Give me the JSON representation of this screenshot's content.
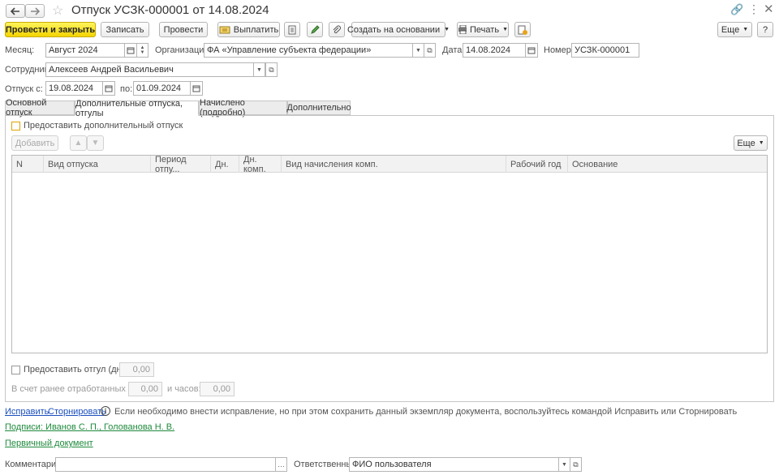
{
  "window": {
    "title": "Отпуск УСЗК-000001 от 14.08.2024"
  },
  "toolbar": {
    "post_close": "Провести и закрыть",
    "save": "Записать",
    "post": "Провести",
    "pay": "Выплатить",
    "create_based": "Создать на основании",
    "print": "Печать",
    "more": "Еще",
    "help": "?"
  },
  "header": {
    "month_label": "Месяц:",
    "month_value": "Август 2024",
    "org_label": "Организация:",
    "org_value": "ФА «Управление субъекта федерации»",
    "date_label": "Дата:",
    "date_value": "14.08.2024",
    "number_label": "Номер:",
    "number_value": "УСЗК-000001",
    "employee_label": "Сотрудник:",
    "employee_value": "Алексеев Андрей Васильевич",
    "vacation_from_label": "Отпуск с:",
    "vacation_from_value": "19.08.2024",
    "vacation_to_label": "по:",
    "vacation_to_value": "01.09.2024"
  },
  "tabs": [
    {
      "label": "Основной отпуск"
    },
    {
      "label": "Дополнительные отпуска, отгулы"
    },
    {
      "label": "Начислено (подробно)"
    },
    {
      "label": "Дополнительно"
    }
  ],
  "additional": {
    "provide_label": "Предоставить дополнительный отпуск",
    "add_button": "Добавить",
    "more": "Еще",
    "columns": [
      "N",
      "Вид отпуска",
      "Период отпу...",
      "Дн.",
      "Дн. комп.",
      "Вид начисления комп.",
      "Рабочий год",
      "Основание"
    ],
    "rows": []
  },
  "dayoff": {
    "provide_label": "Предоставить отгул (дней)",
    "days_value": "0,00",
    "worked_days_label": "В счет ранее отработанных дней:",
    "worked_days_value": "0,00",
    "hours_label": "и часов:",
    "hours_value": "0,00"
  },
  "footer": {
    "fix_link": "Исправить",
    "storno_link": "Сторнировать",
    "info_text": "Если необходимо внести исправление, но при этом сохранить данный экземпляр документа, воспользуйтесь командой Исправить или Сторнировать",
    "signatures_link": "Подписи: Иванов С. П., Голованова Н. В.",
    "primary_doc_link": "Первичный документ",
    "comment_label": "Комментарий:",
    "comment_value": "",
    "responsible_label": "Ответственный:",
    "responsible_value": "ФИО пользователя"
  },
  "colors": {
    "primary_button": "#f3d400",
    "link_blue": "#1a4ebd",
    "link_green": "#1e8a3c"
  }
}
